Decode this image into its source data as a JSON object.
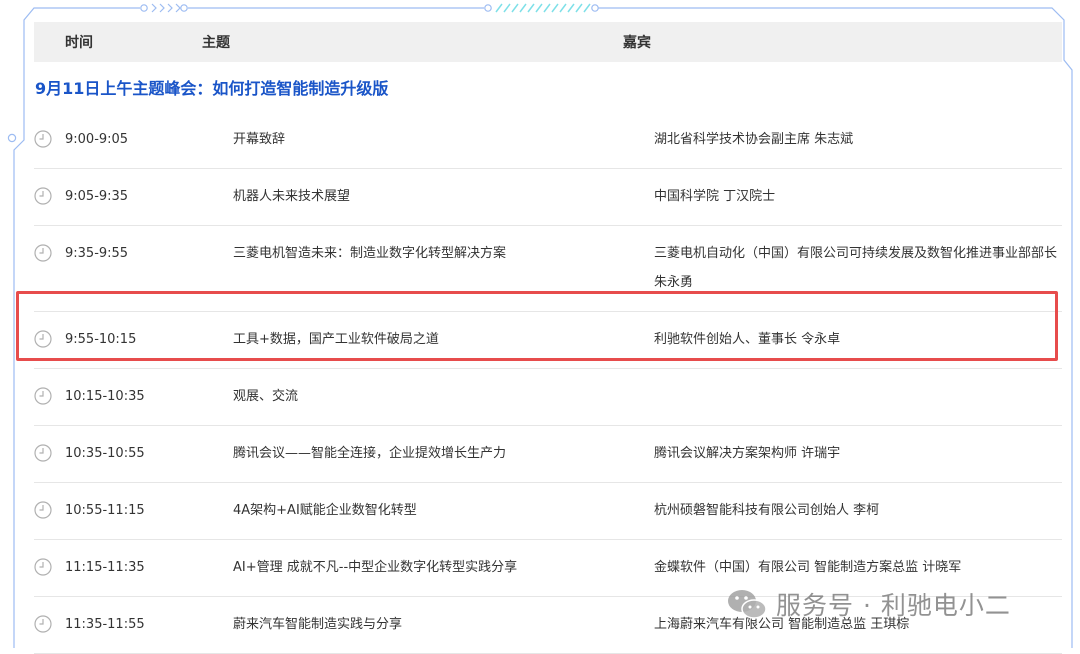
{
  "header": {
    "time": "时间",
    "topic": "主题",
    "guest": "嘉宾"
  },
  "section_title": "9月11日上午主题峰会：如何打造智能制造升级版",
  "rows": [
    {
      "time": "9:00-9:05",
      "topic": "开幕致辞",
      "guest": "湖北省科学技术协会副主席  朱志斌"
    },
    {
      "time": "9:05-9:35",
      "topic": "机器人未来技术展望",
      "guest": "中国科学院    丁汉院士"
    },
    {
      "time": "9:35-9:55",
      "topic": "三菱电机智造未来：制造业数字化转型解决方案",
      "guest": "三菱电机自动化（中国）有限公司可持续发展及数智化推进事业部部长  朱永勇"
    },
    {
      "time": "9:55-10:15",
      "topic": "工具+数据，国产工业软件破局之道",
      "guest": "利驰软件创始人、董事长  令永卓"
    },
    {
      "time": "10:15-10:35",
      "topic": "观展、交流",
      "guest": ""
    },
    {
      "time": "10:35-10:55",
      "topic": "腾讯会议——智能全连接，企业提效增长生产力",
      "guest": "腾讯会议解决方案架构师  许瑞宇"
    },
    {
      "time": "10:55-11:15",
      "topic": "4A架构+AI赋能企业数智化转型",
      "guest": "杭州硕磐智能科技有限公司创始人  李柯"
    },
    {
      "time": "11:15-11:35",
      "topic": "AI+管理  成就不凡--中型企业数字化转型实践分享",
      "guest": "金蝶软件（中国）有限公司  智能制造方案总监  计晓军"
    },
    {
      "time": "11:35-11:55",
      "topic": "蔚来汽车智能制造实践与分享",
      "guest": "上海蔚来汽车有限公司    智能制造总监  王琪棕"
    }
  ],
  "watermark": "服务号 · 利驰电小二",
  "colors": {
    "section": "#1a55c8",
    "highlight": "#e74c4c",
    "frame": "#8fb4ef"
  }
}
